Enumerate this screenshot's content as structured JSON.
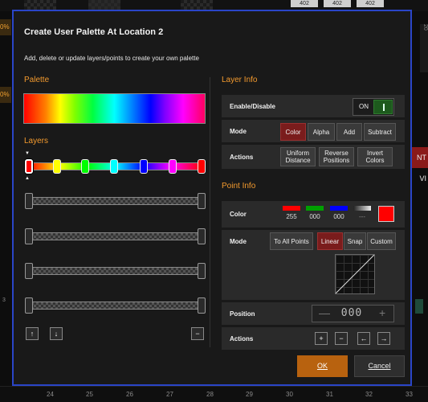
{
  "background": {
    "tab_numbers": [
      "402",
      "402",
      "402"
    ],
    "left_tags": [
      "0%",
      "0%"
    ],
    "red_button": "NT VI",
    "side_text": "20",
    "side_number": "3",
    "ruler": [
      "24",
      "25",
      "26",
      "27",
      "28",
      "29",
      "30",
      "31",
      "32",
      "33"
    ]
  },
  "dialog": {
    "title": "Create User Palette At Location 2",
    "subtitle": "Add, delete or update layers/points to create your own palette",
    "palette_heading": "Palette",
    "layers_heading": "Layers",
    "layer_info_heading": "Layer Info",
    "point_info_heading": "Point Info",
    "layer_info": {
      "enable_label": "Enable/Disable",
      "enable_value": "ON",
      "mode_label": "Mode",
      "mode_options": [
        "Color",
        "Alpha",
        "Add",
        "Subtract"
      ],
      "mode_selected": "Color",
      "actions_label": "Actions",
      "actions": [
        "Uniform Distance",
        "Reverse Positions",
        "Invert Colors"
      ]
    },
    "point_info": {
      "color_label": "Color",
      "color_channels": [
        {
          "value": "255",
          "color": "#ff0000"
        },
        {
          "value": "000",
          "color": "#00a000"
        },
        {
          "value": "000",
          "color": "#0000ff"
        },
        {
          "value": "---",
          "color": "#888888"
        }
      ],
      "mode_label": "Mode",
      "to_all_points": "To All Points",
      "mode_options": [
        "Linear",
        "Snap",
        "Custom"
      ],
      "mode_selected": "Linear",
      "position_label": "Position",
      "position_value": "000",
      "actions_label": "Actions"
    },
    "ok_label": "OK",
    "cancel_label": "Cancel"
  },
  "colors": {
    "accent_border": "#2a45c8",
    "section_heading": "#f39a2e",
    "selected_button": "#7a1c1c",
    "ok_button": "#b8620f",
    "toggle_on": "#1d5a1d"
  },
  "layer_handles": [
    "#ff0000",
    "#ffff00",
    "#00ff00",
    "#00ffff",
    "#0000ff",
    "#ff00ff",
    "#ff0000"
  ]
}
